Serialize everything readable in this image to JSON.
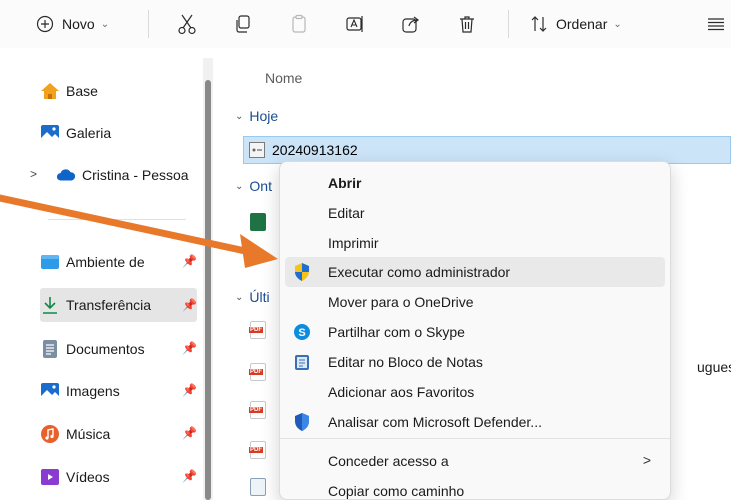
{
  "toolbar": {
    "new_label": "Novo",
    "sort_label": "Ordenar"
  },
  "nav": {
    "items": [
      {
        "label": "Base"
      },
      {
        "label": "Galeria"
      },
      {
        "label": "Cristina - Pessoa"
      },
      {
        "label": "Ambiente de"
      },
      {
        "label": "Transferência"
      },
      {
        "label": "Documentos"
      },
      {
        "label": "Imagens"
      },
      {
        "label": "Música"
      },
      {
        "label": "Vídeos"
      }
    ]
  },
  "main": {
    "column_name": "Nome",
    "groups": [
      "Hoje",
      "Ont",
      "Últi"
    ],
    "selected_file": "20240913162",
    "partial_text": "uguese"
  },
  "context_menu": {
    "items": [
      {
        "label": "Abrir"
      },
      {
        "label": "Editar"
      },
      {
        "label": "Imprimir"
      },
      {
        "label": "Executar como administrador"
      },
      {
        "label": "Mover para o OneDrive"
      },
      {
        "label": "Partilhar com o Skype"
      },
      {
        "label": "Editar no Bloco de Notas"
      },
      {
        "label": "Adicionar aos Favoritos"
      },
      {
        "label": "Analisar com Microsoft Defender..."
      },
      {
        "label": "Conceder acesso a"
      },
      {
        "label": "Copiar como caminho"
      }
    ],
    "submenu_arrow": ">"
  },
  "colors": {
    "accent": "#0067c0",
    "selection": "#cce4f7",
    "annotation_arrow": "#e8782a"
  }
}
